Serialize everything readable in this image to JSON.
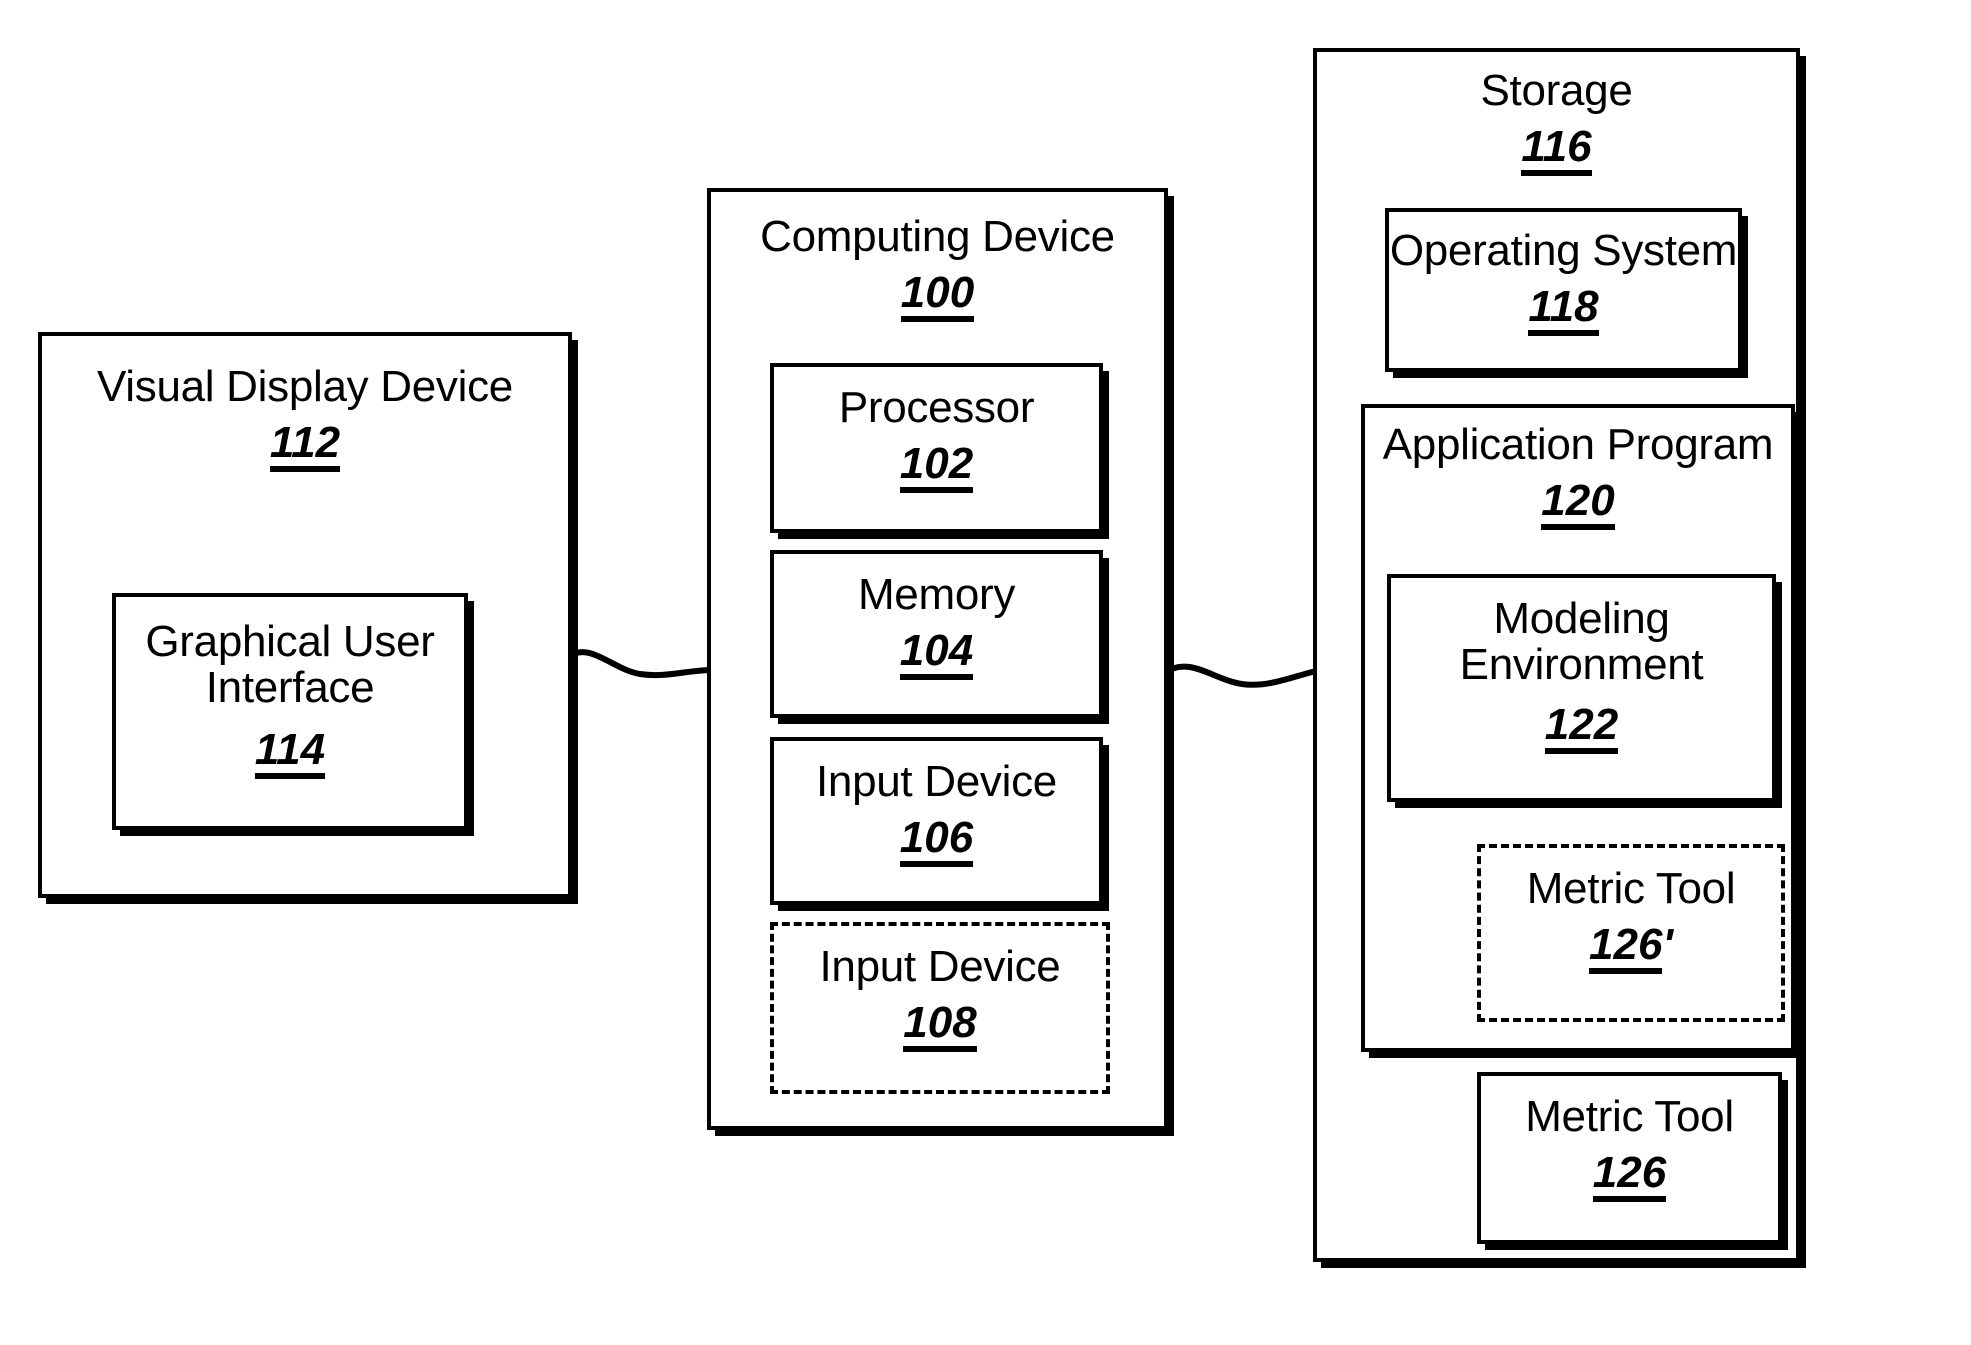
{
  "figure": {
    "type": "patent-block-diagram",
    "blocks": {
      "visual_display_device": {
        "label": "Visual Display Device",
        "ref": "112"
      },
      "graphical_user_interface": {
        "label": "Graphical User\nInterface",
        "ref": "114"
      },
      "computing_device": {
        "label": "Computing Device",
        "ref": "100"
      },
      "processor": {
        "label": "Processor",
        "ref": "102"
      },
      "memory": {
        "label": "Memory",
        "ref": "104"
      },
      "input_device_106": {
        "label": "Input Device",
        "ref": "106"
      },
      "input_device_108": {
        "label": "Input Device",
        "ref": "108"
      },
      "storage": {
        "label": "Storage",
        "ref": "116"
      },
      "operating_system": {
        "label": "Operating System",
        "ref": "118"
      },
      "application_program": {
        "label": "Application Program",
        "ref": "120"
      },
      "modeling_environment": {
        "label": "Modeling\nEnvironment",
        "ref": "122"
      },
      "metric_tool_126_prime": {
        "label": "Metric Tool",
        "ref": "126",
        "ref_suffix": "'"
      },
      "metric_tool_126": {
        "label": "Metric Tool",
        "ref": "126"
      }
    },
    "connectors": [
      {
        "name": "display-to-computing",
        "from": "visual_display_device",
        "to": "computing_device",
        "style": "wavy"
      },
      {
        "name": "computing-to-storage",
        "from": "computing_device",
        "to": "storage",
        "style": "wavy"
      }
    ],
    "colors": {
      "ink": "#000000",
      "paper": "#ffffff"
    }
  }
}
